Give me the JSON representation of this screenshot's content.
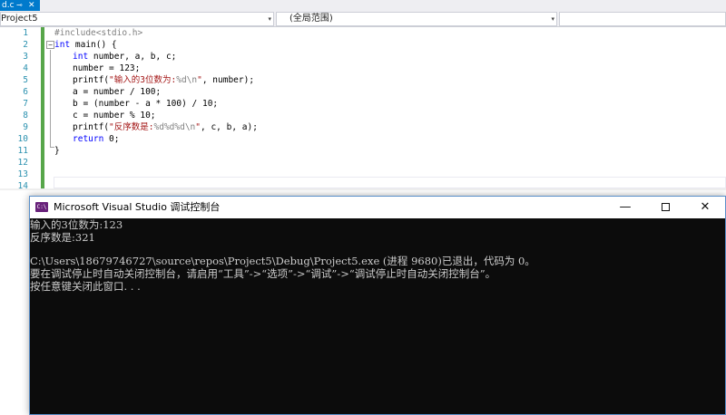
{
  "tab": {
    "filename": "d.c",
    "pin_glyph": "⊸",
    "close_glyph": "✕"
  },
  "navbar": {
    "project": "Project5",
    "scope": "(全局范围)",
    "member": "",
    "chevron": "▾"
  },
  "editor": {
    "line_numbers": [
      "1",
      "2",
      "3",
      "4",
      "5",
      "6",
      "7",
      "8",
      "9",
      "10",
      "11",
      "12",
      "13",
      "14"
    ],
    "collapse_glyph": "−"
  },
  "code": {
    "l1": "#include<stdio.h>",
    "l2_kw": "int",
    "l2_rest": " main() {",
    "l3_kw": "int",
    "l3_rest": " number, a, b, c;",
    "l4": "number = 123;",
    "l5_a": "printf(",
    "l5_s": "\"输入的3位数为:",
    "l5_f": "%d\\n",
    "l5_e": "\"",
    "l5_b": ", number);",
    "l6": "a = number / 100;",
    "l7": "b = (number - a * 100) / 10;",
    "l8": "c = number % 10;",
    "l9_a": "printf(",
    "l9_s": "\"反序数是:",
    "l9_f": "%d%d%d\\n",
    "l9_e": "\"",
    "l9_b": ", c, b, a);",
    "l10_kw": "return",
    "l10_rest": " 0;",
    "l11": "}"
  },
  "console": {
    "icon_text": "C:\\",
    "title": "Microsoft Visual Studio 调试控制台",
    "minimize": "—",
    "close": "✕",
    "lines": [
      "输入的3位数为:123",
      "反序数是:321",
      "",
      "C:\\Users\\18679746727\\source\\repos\\Project5\\Debug\\Project5.exe (进程 9680)已退出，代码为 0。",
      "要在调试停止时自动关闭控制台，请启用“工具”->“选项”->“调试”->“调试停止时自动关闭控制台”。",
      "按任意键关闭此窗口. . ."
    ]
  }
}
